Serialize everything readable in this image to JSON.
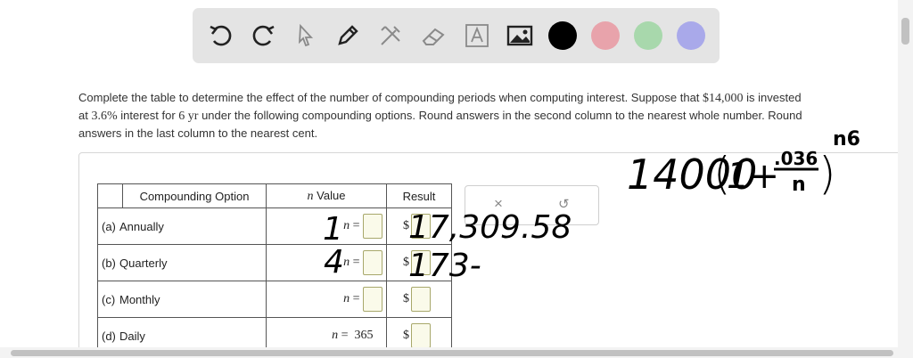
{
  "toolbar": {
    "tools": [
      "undo-icon",
      "redo-icon",
      "pointer-icon",
      "pen-icon",
      "tools-icon",
      "eraser-icon",
      "text-icon",
      "image-icon"
    ],
    "colors": [
      "#000000",
      "#e8a3ab",
      "#a8d8ac",
      "#a9a9ea"
    ]
  },
  "problem": {
    "text_start": "Complete the table to determine the effect of the number of compounding periods when computing interest. Suppose that ",
    "amount": "$14,000",
    "text_mid1": " is invested at ",
    "rate": "3.6%",
    "text_mid2": " interest for ",
    "years": "6 yr",
    "text_end": " under the following compounding options. Round answers in the second column to the nearest whole number. Round answers in the last column to the nearest cent."
  },
  "table": {
    "headers": [
      "Compounding Option",
      "n Value",
      "Result"
    ],
    "n_var": "n",
    "equals": "=",
    "currency": "$",
    "rows": [
      {
        "letter": "(a)",
        "label": "Annually",
        "n": ""
      },
      {
        "letter": "(b)",
        "label": "Quarterly",
        "n": ""
      },
      {
        "letter": "(c)",
        "label": "Monthly",
        "n": ""
      },
      {
        "letter": "(d)",
        "label": "Daily",
        "n": "365"
      }
    ]
  },
  "widget": {
    "clear_symbol": "×",
    "reset_symbol": "↺"
  },
  "handwriting": {
    "formula": "14000(1+.036/n)^n6",
    "row_a_n": "1",
    "row_a_result": "17,309.58",
    "row_b_n": "4",
    "row_b_result": "173-"
  }
}
